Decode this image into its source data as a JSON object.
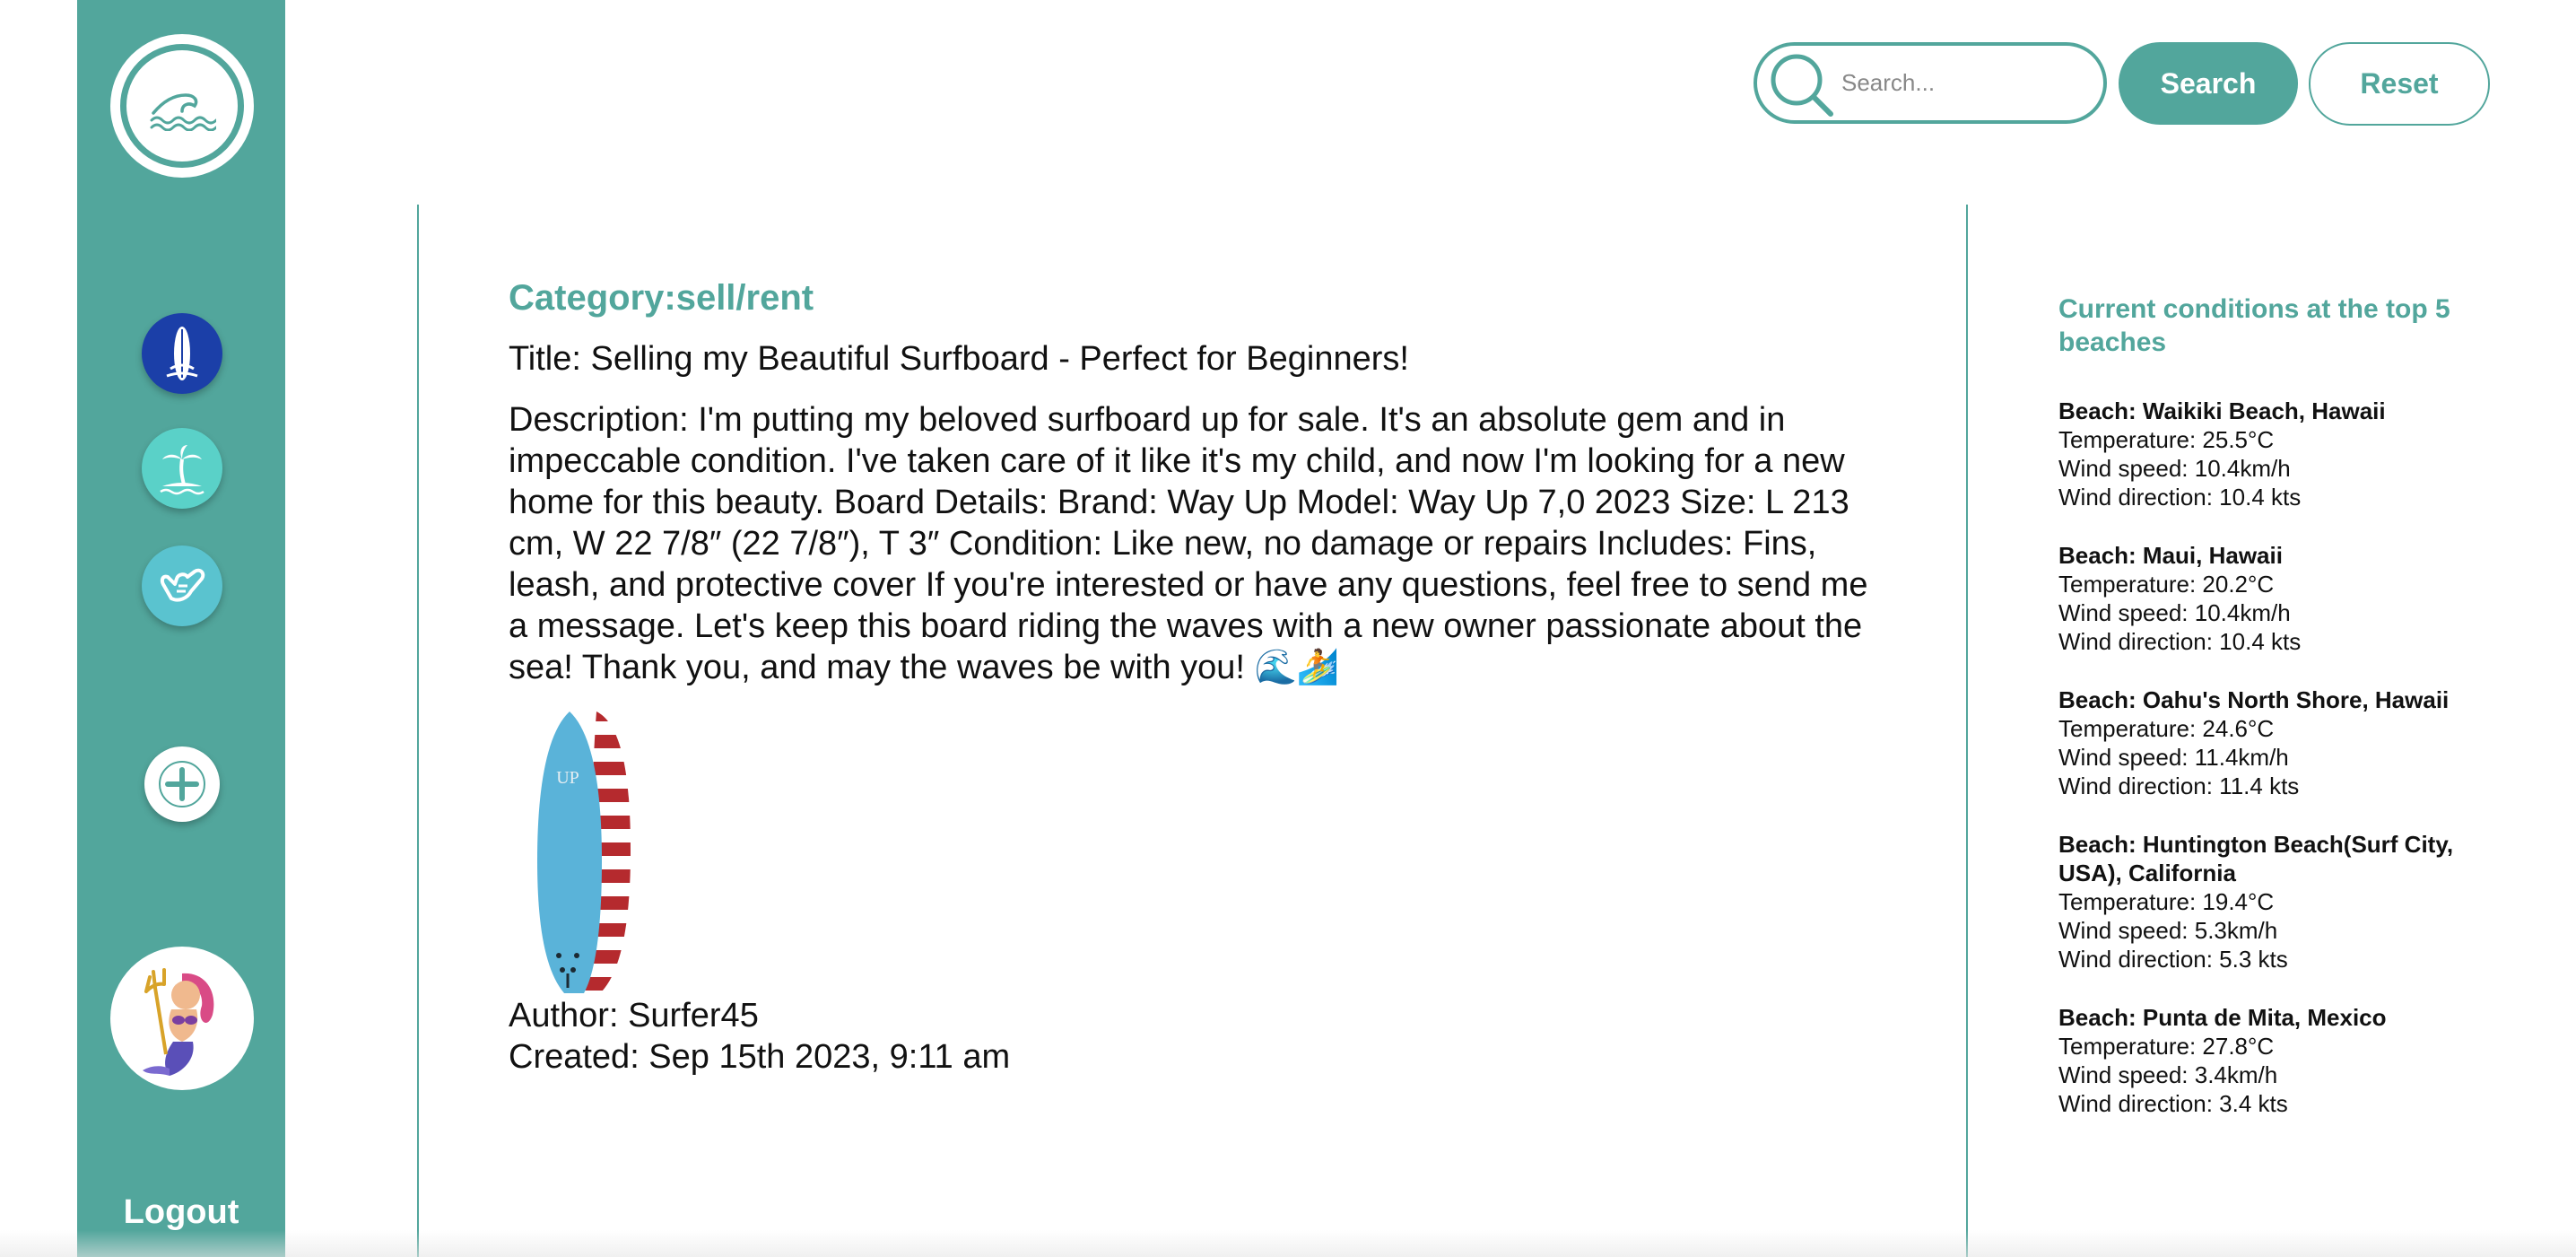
{
  "sidebar": {
    "logo": "wave-logo-icon",
    "nav": [
      {
        "name": "surfboard-icon",
        "color": "#1b3fa8"
      },
      {
        "name": "palm-island-icon",
        "color": "#5ad1c8"
      },
      {
        "name": "shaka-hand-icon",
        "color": "#5ac3cf"
      }
    ],
    "add_icon": "plus-icon",
    "avatar": "mermaid-avatar",
    "logout_label": "Logout"
  },
  "header": {
    "search_placeholder": "Search...",
    "search_value": "",
    "search_label": "Search",
    "reset_label": "Reset"
  },
  "post": {
    "category": "Category:sell/rent",
    "title": "Title: Selling my Beautiful Surfboard - Perfect for Beginners!",
    "description": "Description: I'm putting my beloved surfboard up for sale. It's an absolute gem and in impeccable condition. I've taken care of it like it's my child, and now I'm looking for a new home for this beauty. Board Details: Brand: Way Up Model: Way Up 7,0 2023 Size: L 213 cm, W 22 7/8″ (22 7/8″), T 3″ Condition: Like new, no damage or repairs Includes: Fins, leash, and protective cover If you're interested or have any questions, feel free to send me a message. Let's keep this board riding the waves with a new owner passionate about the sea! Thank you, and may the waves be with you! 🌊🏄",
    "image_text": "UP",
    "author": "Author: Surfer45",
    "created": "Created: Sep 15th 2023, 9:11 am"
  },
  "conditions": {
    "title": "Current conditions at the top 5 beaches",
    "beaches": [
      {
        "name": "Beach: Waikiki Beach, Hawaii",
        "temperature": "Temperature: 25.5°C",
        "wind_speed": "Wind speed: 10.4km/h",
        "wind_direction": "Wind direction: 10.4 kts"
      },
      {
        "name": "Beach: Maui, Hawaii",
        "temperature": "Temperature: 20.2°C",
        "wind_speed": "Wind speed: 10.4km/h",
        "wind_direction": "Wind direction: 10.4 kts"
      },
      {
        "name": "Beach: Oahu's North Shore, Hawaii",
        "temperature": "Temperature: 24.6°C",
        "wind_speed": "Wind speed: 11.4km/h",
        "wind_direction": "Wind direction: 11.4 kts"
      },
      {
        "name": "Beach: Huntington Beach(Surf City, USA), California",
        "temperature": "Temperature: 19.4°C",
        "wind_speed": "Wind speed: 5.3km/h",
        "wind_direction": "Wind direction: 5.3 kts"
      },
      {
        "name": "Beach: Punta de Mita, Mexico",
        "temperature": "Temperature: 27.8°C",
        "wind_speed": "Wind speed: 3.4km/h",
        "wind_direction": "Wind direction: 3.4 kts"
      }
    ]
  },
  "colors": {
    "accent": "#52a69c",
    "white": "#ffffff"
  }
}
